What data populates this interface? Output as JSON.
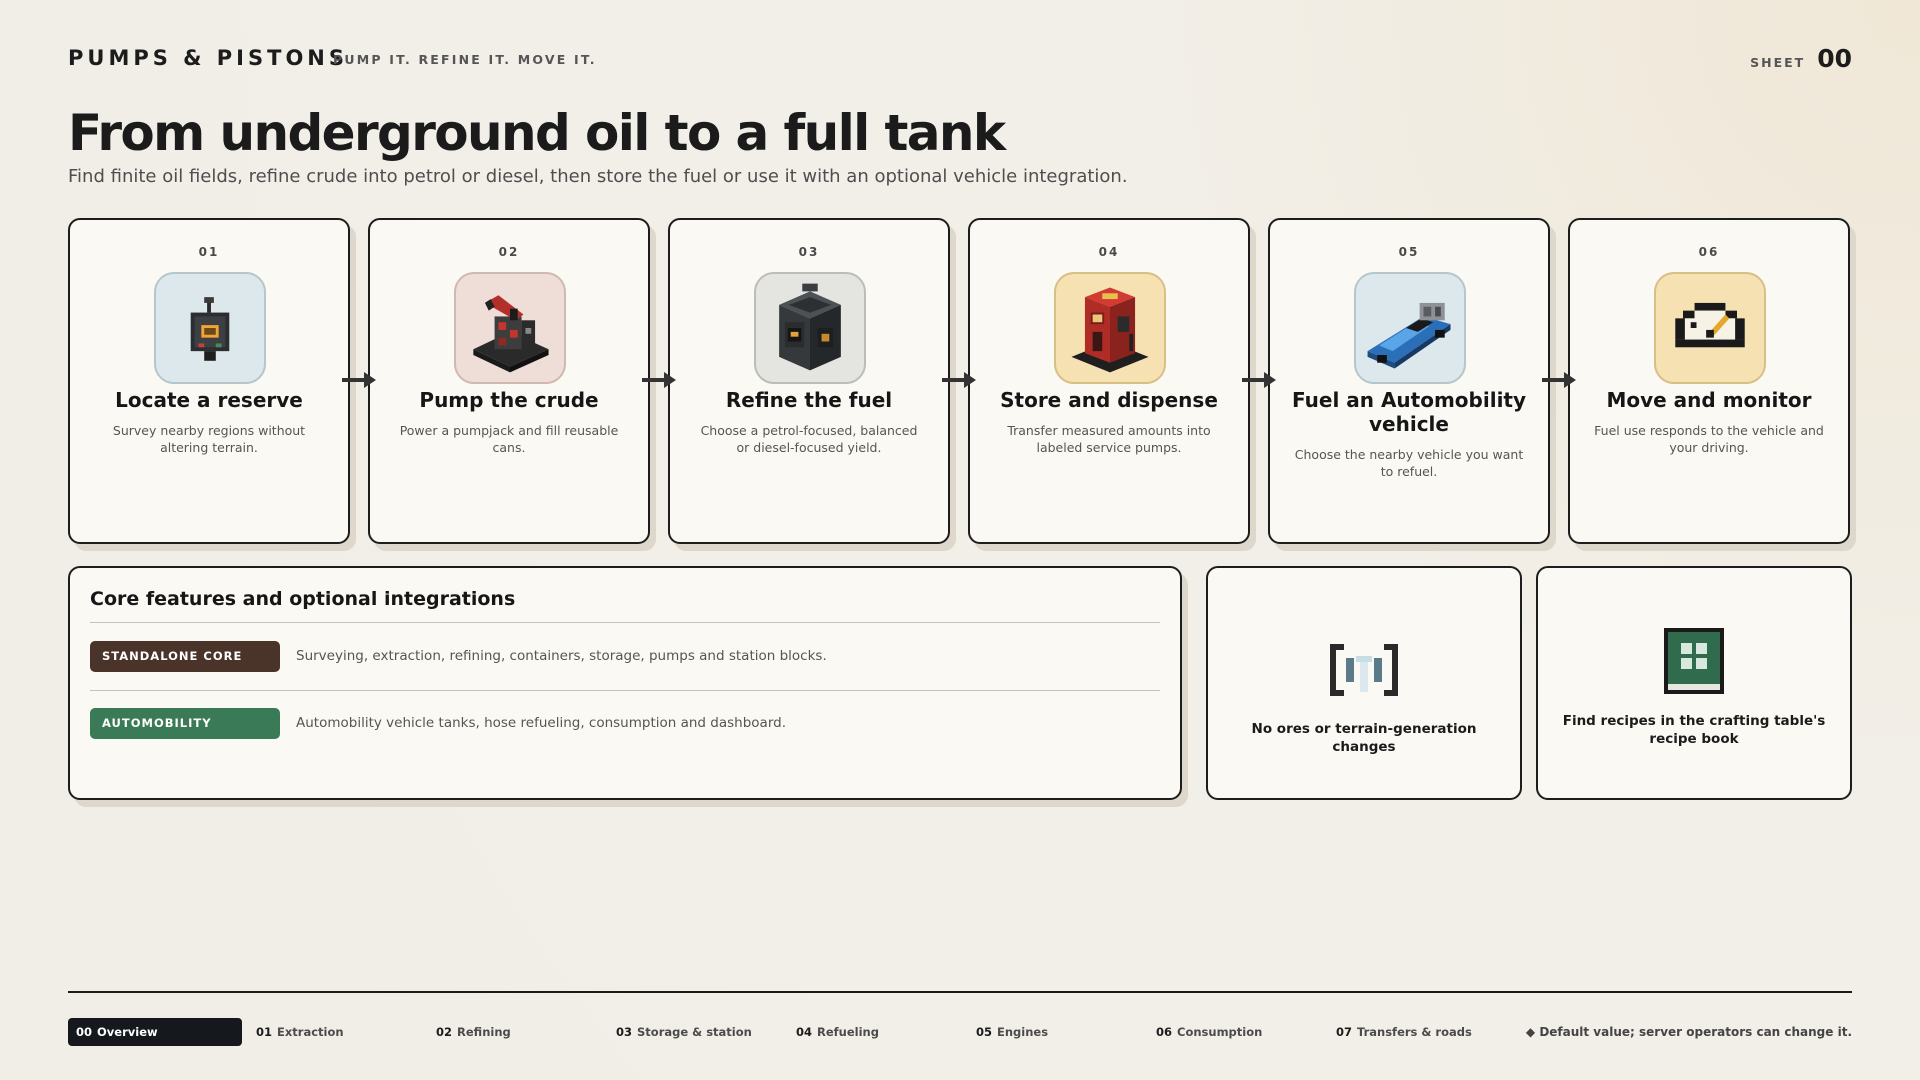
{
  "header": {
    "brand": "PUMPS & PISTONS",
    "tagline": "PUMP IT. REFINE IT. MOVE IT.",
    "sheet_label": "SHEET",
    "sheet_number": "00"
  },
  "hero": {
    "title": "From underground oil to a full tank",
    "subtitle": "Find finite oil fields, refine crude into petrol or diesel, then store the fuel or use it with an optional vehicle integration."
  },
  "steps": [
    {
      "number": "01",
      "title": "Locate a reserve",
      "description": "Survey nearby regions without altering terrain.",
      "icon": "survey-device-icon"
    },
    {
      "number": "02",
      "title": "Pump the crude",
      "description": "Power a pumpjack and fill reusable cans.",
      "icon": "pumpjack-icon"
    },
    {
      "number": "03",
      "title": "Refine the fuel",
      "description": "Choose a petrol-focused, balanced or diesel-focused yield.",
      "icon": "refinery-icon"
    },
    {
      "number": "04",
      "title": "Store and dispense",
      "description": "Transfer measured amounts into labeled service pumps.",
      "icon": "fuel-pump-icon"
    },
    {
      "number": "05",
      "title": "Fuel an Automobility vehicle",
      "description": "Choose the nearby vehicle you want to refuel.",
      "icon": "vehicle-icon"
    },
    {
      "number": "06",
      "title": "Move and monitor",
      "description": "Fuel use responds to the vehicle and your driving.",
      "icon": "gauge-icon"
    }
  ],
  "features": {
    "title": "Core features and optional integrations",
    "rows": [
      {
        "label": "STANDALONE CORE",
        "description": "Surveying, extraction, refining, containers, storage, pumps and station blocks.",
        "color": "#4a3329"
      },
      {
        "label": "AUTOMOBILITY",
        "description": "Automobility vehicle tanks, hose refueling, consumption and dashboard.",
        "color": "#3b7a56"
      }
    ]
  },
  "cards": [
    {
      "text": "No ores or terrain-generation changes",
      "icon": "structure-void-icon"
    },
    {
      "text": "Find recipes in the crafting table's recipe book",
      "icon": "recipe-book-icon"
    }
  ],
  "nav": {
    "items": [
      {
        "num": "00",
        "label": "Overview",
        "active": true
      },
      {
        "num": "01",
        "label": "Extraction"
      },
      {
        "num": "02",
        "label": "Refining"
      },
      {
        "num": "03",
        "label": "Storage & station"
      },
      {
        "num": "04",
        "label": "Refueling"
      },
      {
        "num": "05",
        "label": "Engines"
      },
      {
        "num": "06",
        "label": "Consumption"
      },
      {
        "num": "07",
        "label": "Transfers & roads"
      }
    ],
    "note": "◆ Default value; server operators can change it."
  },
  "colors": {
    "ink": "#1b1b1b",
    "paper": "#fbf9f3",
    "core": "#4a3329",
    "automobility": "#3b7a56",
    "active_nav": "#15181d"
  }
}
